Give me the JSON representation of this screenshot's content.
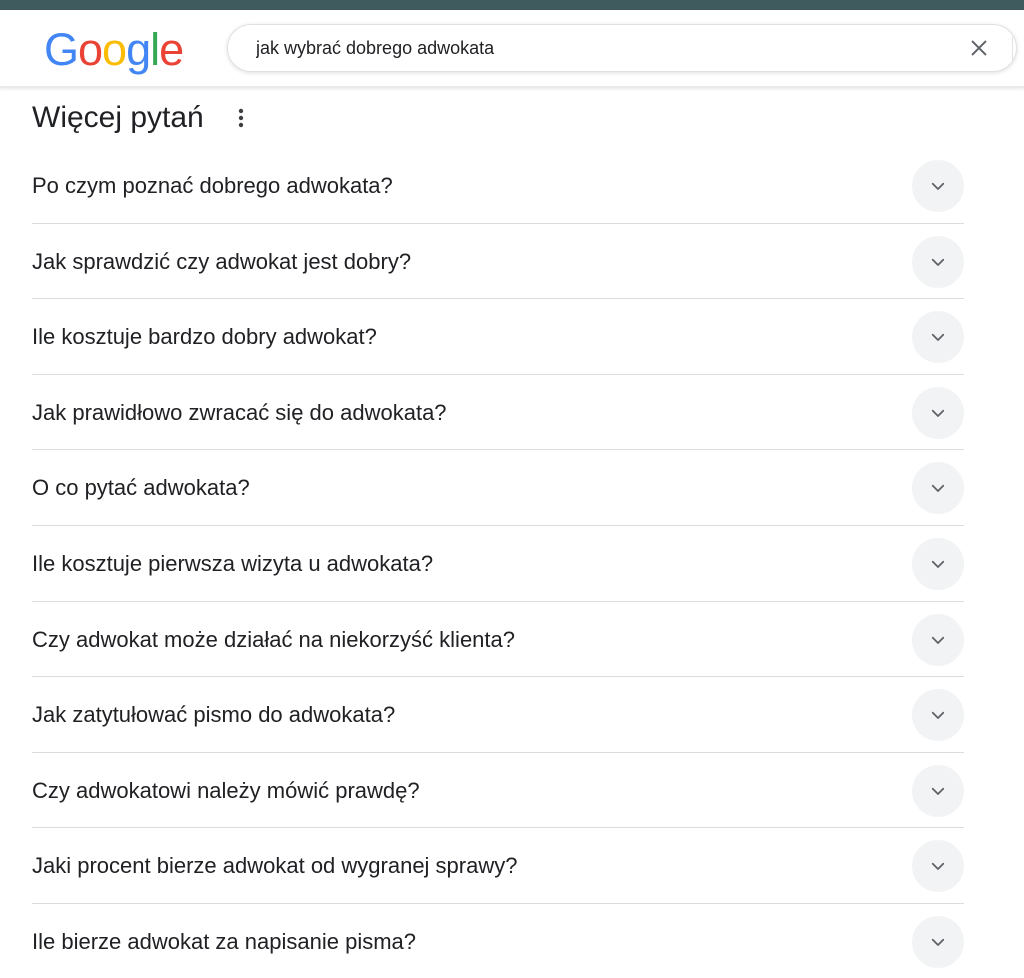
{
  "header": {
    "logo_letters": [
      {
        "char": "G",
        "color": "#4285F4"
      },
      {
        "char": "o",
        "color": "#EA4335"
      },
      {
        "char": "o",
        "color": "#FBBC05"
      },
      {
        "char": "g",
        "color": "#4285F4"
      },
      {
        "char": "l",
        "color": "#34A853"
      },
      {
        "char": "e",
        "color": "#EA4335"
      }
    ],
    "search_value": "jak wybrać dobrego adwokata",
    "clear_icon": "close-icon"
  },
  "section": {
    "title": "Więcej pytań",
    "menu_icon": "more-vert-icon"
  },
  "questions": [
    {
      "text": "Po czym poznać dobrego adwokata?"
    },
    {
      "text": "Jak sprawdzić czy adwokat jest dobry?"
    },
    {
      "text": "Ile kosztuje bardzo dobry adwokat?"
    },
    {
      "text": "Jak prawidłowo zwracać się do adwokata?"
    },
    {
      "text": "O co pytać adwokata?"
    },
    {
      "text": "Ile kosztuje pierwsza wizyta u adwokata?"
    },
    {
      "text": "Czy adwokat może działać na niekorzyść klienta?"
    },
    {
      "text": "Jak zatytułować pismo do adwokata?"
    },
    {
      "text": "Czy adwokatowi należy mówić prawdę?"
    },
    {
      "text": "Jaki procent bierze adwokat od wygranej sprawy?"
    },
    {
      "text": "Ile bierze adwokat za napisanie pisma?"
    }
  ],
  "colors": {
    "top_strip": "#3f5b5e",
    "chevron_bg": "#f1f3f4",
    "divider": "#dadce0",
    "text": "#202124"
  }
}
